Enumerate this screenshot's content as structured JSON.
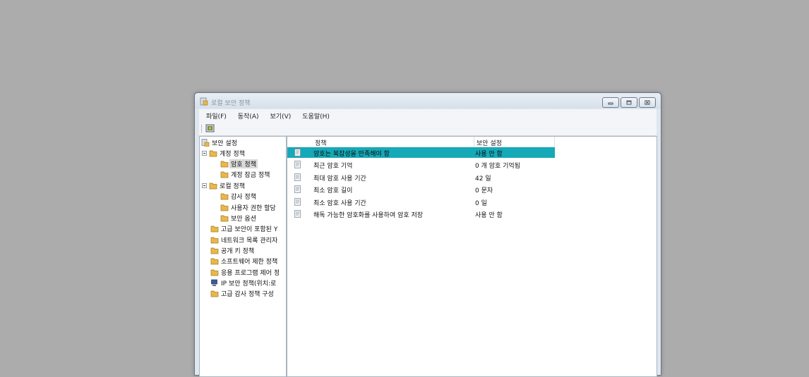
{
  "window": {
    "title": "로컬 보안 정책"
  },
  "menu": [
    "파일(F)",
    "동작(A)",
    "보기(V)",
    "도움말(H)"
  ],
  "tree": {
    "root": "보안 설정",
    "account_policy": "계정 정책",
    "password_policy": "암호 정책",
    "lockout_policy": "계정 잠금 정책",
    "local_policy": "로컬 정책",
    "audit_policy": "감사 정책",
    "user_rights": "사용자 권한 할당",
    "security_options": "보안 옵션",
    "advanced_firewall": "고급 보안이 포함된 Y",
    "network_list": "네트워크 목록 관리자",
    "public_key": "공개 키 정책",
    "software_restriction": "소프트웨어 제한 정책",
    "app_control": "응용 프로그램 제어 정",
    "ip_security": "IP 보안 정책(위치:로",
    "advanced_audit": "고급 감사 정책 구성"
  },
  "list": {
    "columns": {
      "policy": "정책",
      "setting": "보안 설정"
    },
    "rows": [
      {
        "policy": "암호는 복잡성을 만족해야 함",
        "setting": "사용 안 함",
        "selected": true
      },
      {
        "policy": "최근 암호 기억",
        "setting": "0 개 암호 기억됨",
        "selected": false
      },
      {
        "policy": "최대 암호 사용 기간",
        "setting": "42 일",
        "selected": false
      },
      {
        "policy": "최소 암호 길이",
        "setting": "0 문자",
        "selected": false
      },
      {
        "policy": "최소 암호 사용 기간",
        "setting": "0 일",
        "selected": false
      },
      {
        "policy": "해독 가능한 암호화를 사용하여 암호 저장",
        "setting": "사용 안 함",
        "selected": false
      }
    ]
  },
  "colors": {
    "desktop": "#acacac",
    "selection": "#16a9b7",
    "folder": "#e8b84a"
  }
}
